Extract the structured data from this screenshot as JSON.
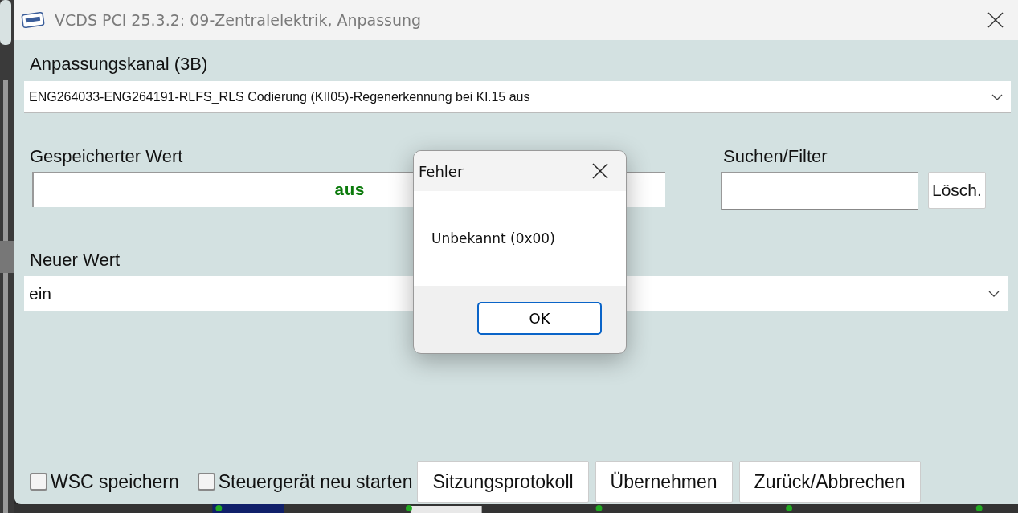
{
  "window": {
    "title": "VCDS PCI 25.3.2: 09-Zentralelektrik,  Anpassung"
  },
  "channel": {
    "label": "Anpassungskanal (3B)",
    "value": "ENG264033-ENG264191-RLFS_RLS Codierung (KII05)-Regenerkennung bei Kl.15 aus"
  },
  "stored": {
    "label": "Gespeicherter Wert",
    "value": "aus"
  },
  "search": {
    "label": "Suchen/Filter",
    "clear_button": "Lösch."
  },
  "new_value": {
    "label": "Neuer Wert",
    "value": "ein"
  },
  "checkboxes": [
    {
      "label": "WSC speichern",
      "checked": false
    },
    {
      "label": "Steuergerät neu starten",
      "checked": false
    }
  ],
  "buttons": [
    "Sitzungsprotokoll",
    "Übernehmen",
    "Zurück/Abbrechen"
  ],
  "dialog": {
    "title": "Fehler",
    "message": "Unbekannt (0x00)",
    "button": "OK"
  }
}
